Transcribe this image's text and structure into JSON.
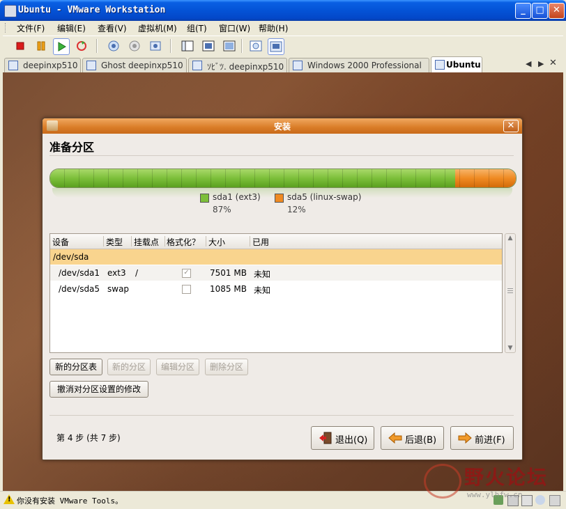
{
  "window": {
    "title": "Ubuntu - VMware Workstation",
    "buttons": {
      "minimize": "_",
      "maximize": "□",
      "close": "✕"
    }
  },
  "menu": [
    "文件(F)",
    "编辑(E)",
    "查看(V)",
    "虚拟机(M)",
    "组(T)",
    "窗口(W)",
    "帮助(H)"
  ],
  "toolbar": {
    "icons": [
      "power-off-icon",
      "pause-icon",
      "power-on-icon",
      "reset-icon",
      "snapshot-icon",
      "revert-snapshot-icon",
      "snapshot-manager-icon",
      "normal-view-icon",
      "full-screen-icon",
      "quick-switch-icon",
      "summary-view-icon",
      "console-view-icon"
    ]
  },
  "tabs": [
    {
      "label": "deepinxp510",
      "active": false
    },
    {
      "label": "Ghost deepinxp510",
      "active": false
    },
    {
      "label": "ｿﾋﾞﾂ. deepinxp510",
      "active": false
    },
    {
      "label": "Windows 2000 Professional",
      "active": false
    },
    {
      "label": "Ubuntu",
      "active": true
    }
  ],
  "tab_controls": [
    "◀",
    "▶",
    "✕"
  ],
  "dialog": {
    "title": "安装",
    "close": "✕",
    "heading": "准备分区",
    "partition_bar": {
      "segments": [
        {
          "name": "sda1 (ext3)",
          "percent_label": "87%",
          "fraction": 0.87,
          "color": "#7cbf3a"
        },
        {
          "name": "sda5 (linux-swap)",
          "percent_label": "12%",
          "fraction": 0.12,
          "color": "#ef8a22"
        }
      ]
    },
    "table": {
      "columns": [
        "设备",
        "类型",
        "挂载点",
        "格式化？",
        "大小",
        "已用"
      ],
      "rows": [
        {
          "device": "/dev/sda",
          "type": "",
          "mount": "",
          "format": null,
          "size": "",
          "used": ""
        },
        {
          "device": "/dev/sda1",
          "type": "ext3",
          "mount": "/",
          "format": true,
          "size": "7501 MB",
          "used": "未知"
        },
        {
          "device": "/dev/sda5",
          "type": "swap",
          "mount": "",
          "format": false,
          "size": "1085 MB",
          "used": "未知"
        }
      ],
      "checked_glyph": "✓"
    },
    "buttons": {
      "new_table": "新的分区表",
      "new_partition": "新的分区",
      "edit_partition": "编辑分区",
      "delete_partition": "删除分区",
      "undo": "撤消对分区设置的修改",
      "quit": "退出(Q)",
      "back": "后退(B)",
      "forward": "前进(F)"
    },
    "step_text": "第 4 步 (共 7 步)"
  },
  "statusbar": {
    "text": "你没有安装 VMware Tools。"
  },
  "watermark": {
    "text": "野火论坛",
    "url": "www.ylhfw.cn"
  },
  "colors": {
    "xp_blue": "#0453d6",
    "dialog_title_orange": "#d97c27",
    "selected_row": "#f9d48e"
  }
}
